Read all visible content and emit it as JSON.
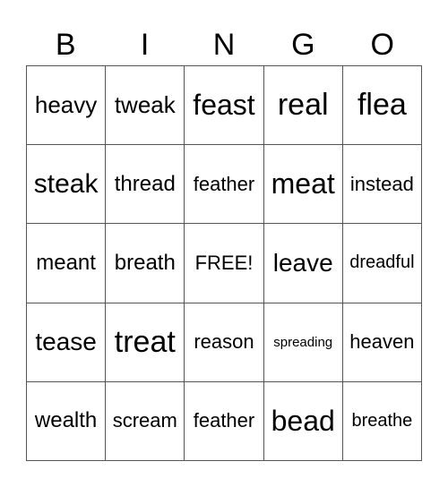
{
  "header": [
    "B",
    "I",
    "N",
    "G",
    "O"
  ],
  "cells": [
    [
      "heavy",
      "tweak",
      "feast",
      "real",
      "flea"
    ],
    [
      "steak",
      "thread",
      "feather",
      "meat",
      "instead"
    ],
    [
      "meant",
      "breath",
      "FREE!",
      "leave",
      "dreadful"
    ],
    [
      "tease",
      "treat",
      "reason",
      "spreading",
      "heaven"
    ],
    [
      "wealth",
      "scream",
      "feather",
      "bead",
      "breathe"
    ]
  ]
}
